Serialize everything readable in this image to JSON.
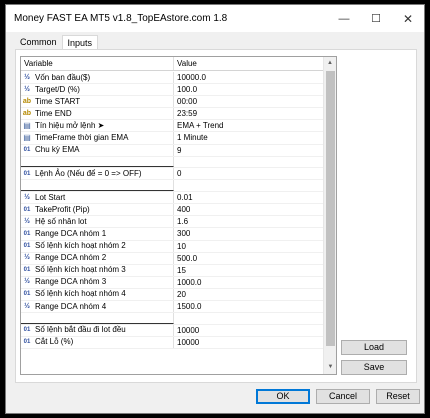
{
  "window": {
    "title": "Money FAST EA MT5 v1.8_TopEAstore.com 1.8"
  },
  "controls": {
    "minimize": "—",
    "maximize": "☐",
    "close": "✕"
  },
  "tabs": [
    {
      "label": "Common"
    },
    {
      "label": "Inputs"
    }
  ],
  "grid": {
    "headers": {
      "variable": "Variable",
      "value": "Value"
    },
    "rows": [
      {
        "icon": "½",
        "type": "frac",
        "name": "Vốn ban đầu($)",
        "value": "10000.0"
      },
      {
        "icon": "½",
        "type": "frac",
        "name": "Target/D (%)",
        "value": "100.0"
      },
      {
        "icon": "ab",
        "type": "ab",
        "name": "Time START",
        "value": "00:00"
      },
      {
        "icon": "ab",
        "type": "ab",
        "name": "Time END",
        "value": "23:59"
      },
      {
        "icon": "▤",
        "type": "enum",
        "name": "Tín hiệu mở lệnh ➤",
        "value": "EMA + Trend"
      },
      {
        "icon": "▤",
        "type": "enum",
        "name": "TimeFrame thời gian EMA",
        "value": "1 Minute"
      },
      {
        "icon": "01",
        "type": "num",
        "name": "Chu kỳ EMA",
        "value": "9"
      },
      {
        "icon": "",
        "type": "sep",
        "name": "______________________",
        "value": ""
      },
      {
        "icon": "01",
        "type": "num",
        "name": "Lệnh Ảo (Nếu để = 0 => OFF)",
        "value": "0"
      },
      {
        "icon": "",
        "type": "sep",
        "name": "______________________",
        "value": ""
      },
      {
        "icon": "½",
        "type": "frac",
        "name": "Lot Start",
        "value": "0.01"
      },
      {
        "icon": "01",
        "type": "num",
        "name": "TakeProfit (Pip)",
        "value": "400"
      },
      {
        "icon": "½",
        "type": "frac",
        "name": "Hệ số nhân lot",
        "value": "1.6"
      },
      {
        "icon": "01",
        "type": "num",
        "name": "Range DCA nhóm 1",
        "value": "300"
      },
      {
        "icon": "01",
        "type": "num",
        "name": "Số lệnh kích hoạt nhóm 2",
        "value": "10"
      },
      {
        "icon": "½",
        "type": "frac",
        "name": "Range DCA nhóm 2",
        "value": "500.0"
      },
      {
        "icon": "01",
        "type": "num",
        "name": "Số lệnh kích hoạt nhóm 3",
        "value": "15"
      },
      {
        "icon": "½",
        "type": "frac",
        "name": "Range DCA nhóm 3",
        "value": "1000.0"
      },
      {
        "icon": "01",
        "type": "num",
        "name": "Số lệnh kích hoạt nhóm 4",
        "value": "20"
      },
      {
        "icon": "½",
        "type": "frac",
        "name": "Range DCA nhóm 4",
        "value": "1500.0"
      },
      {
        "icon": "",
        "type": "sep",
        "name": "______________________",
        "value": ""
      },
      {
        "icon": "01",
        "type": "num",
        "name": "Số lệnh bắt đầu đi lot đều",
        "value": "10000"
      },
      {
        "icon": "01",
        "type": "num",
        "name": "Cắt Lỗ (%)",
        "value": "10000"
      }
    ]
  },
  "side_buttons": {
    "load": "Load",
    "save": "Save"
  },
  "footer_buttons": {
    "ok": "OK",
    "cancel": "Cancel",
    "reset": "Reset"
  }
}
